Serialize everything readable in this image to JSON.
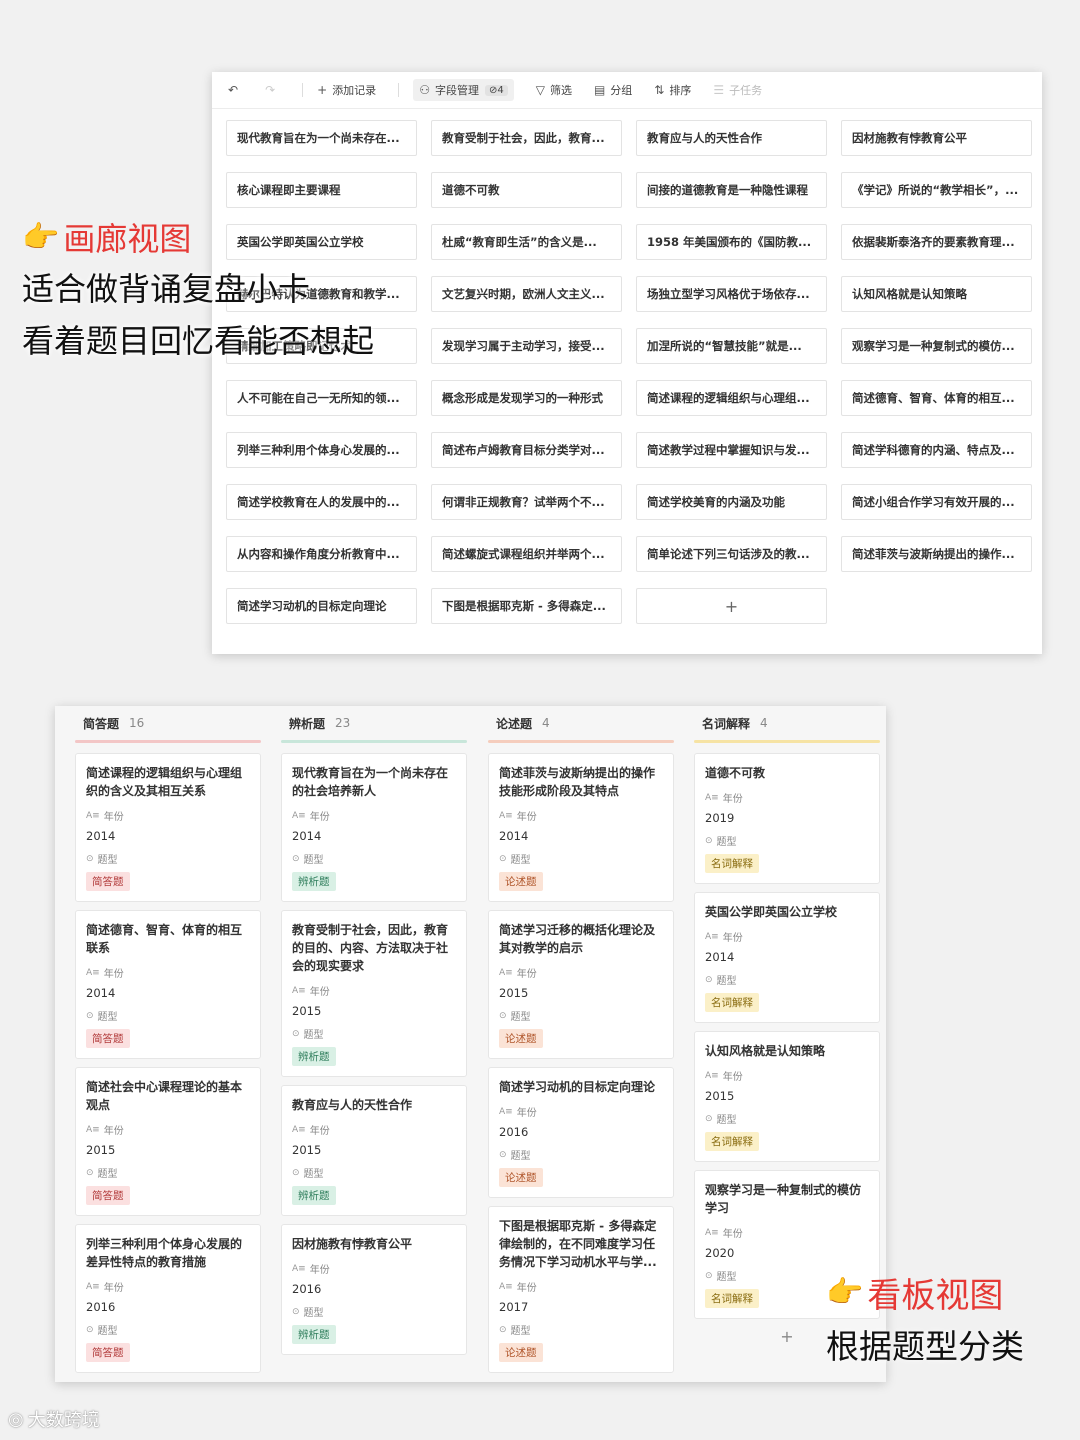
{
  "toolbar": {
    "undo_icon": "undo-icon",
    "redo_icon": "redo-icon",
    "add_record": "添加记录",
    "field_manage": "字段管理",
    "hidden_count": "4",
    "filter": "筛选",
    "group": "分组",
    "sort": "排序",
    "subtask": "子任务"
  },
  "gallery": {
    "cards": [
      "现代教育旨在为一个尚未存在...",
      "教育受制于社会，因此，教育...",
      "教育应与人的天性合作",
      "因材施教有悖教育公平",
      "核心课程即主要课程",
      "道德不可教",
      "间接的道德教育是一种隐性课程",
      "《学记》所说的“教学相长”，...",
      "英国公学即英国公立学校",
      "杜威“教育即生活”的含义是...",
      "1958 年美国颁布的《国防教...",
      "依据裴斯泰洛齐的要素教育理...",
      "赫尔巴特认为道德教育和教学...",
      "文艺复兴时期，欧洲人文主义...",
      "场独立型学习风格优于场依存...",
      "认知风格就是认知策略",
      "精细加工策略即记忆术",
      "发现学习属于主动学习，接受...",
      "加涅所说的“智慧技能”就是...",
      "观察学习是一种复制式的模仿...",
      "人不可能在自己一无所知的领...",
      "概念形成是发现学习的一种形式",
      "简述课程的逻辑组织与心理组...",
      "简述德育、智育、体育的相互...",
      "列举三种利用个体身心发展的...",
      "简述布卢姆教育目标分类学对...",
      "简述教学过程中掌握知识与发...",
      "简述学科德育的内涵、特点及...",
      "简述学校教育在人的发展中的...",
      "何谓非正规教育？试举两个不...",
      "简述学校美育的内涵及功能",
      "简述小组合作学习有效开展的...",
      "从内容和操作角度分析教育中...",
      "简述螺旋式课程组织并举两个...",
      "简单论述下列三句话涉及的教...",
      "简述菲茨与波斯纳提出的操作...",
      "简述学习动机的目标定向理论",
      "下图是根据耶克斯 - 多得森定..."
    ],
    "add_label": "+"
  },
  "caption_left": {
    "hand": "👉",
    "title": "画廊视图",
    "line1": "适合做背诵复盘小卡",
    "line2": "看着题目回忆看能否想起"
  },
  "kanban": {
    "field_year": "年份",
    "field_type": "题型",
    "add_label": "+",
    "columns": [
      {
        "name": "简答题",
        "count": "16",
        "bar_color": "#f3c6c6",
        "tag_bg": "#fbe0e0",
        "tag_fg": "#b23b3b",
        "cards": [
          {
            "title": "简述课程的逻辑组织与心理组织的含义及其相互关系",
            "year": "2014",
            "tag": "简答题"
          },
          {
            "title": "简述德育、智育、体育的相互联系",
            "year": "2014",
            "tag": "简答题"
          },
          {
            "title": "简述社会中心课程理论的基本观点",
            "year": "2015",
            "tag": "简答题"
          },
          {
            "title": "列举三种利用个体身心发展的差异性特点的教育措施",
            "year": "2016",
            "tag": "简答题"
          }
        ]
      },
      {
        "name": "辨析题",
        "count": "23",
        "bar_color": "#c8e6da",
        "tag_bg": "#d9f0e5",
        "tag_fg": "#2e7d5b",
        "cards": [
          {
            "title": "现代教育旨在为一个尚未存在的社会培养新人",
            "year": "2014",
            "tag": "辨析题"
          },
          {
            "title": "教育受制于社会，因此，教育的目的、内容、方法取决于社会的现实要求",
            "year": "2015",
            "tag": "辨析题"
          },
          {
            "title": "教育应与人的天性合作",
            "year": "2015",
            "tag": "辨析题"
          },
          {
            "title": "因材施教有悖教育公平",
            "year": "2016",
            "tag": "辨析题"
          }
        ]
      },
      {
        "name": "论述题",
        "count": "4",
        "bar_color": "#f5cdbd",
        "tag_bg": "#fbe3d6",
        "tag_fg": "#b0562b",
        "cards": [
          {
            "title": "简述菲茨与波斯纳提出的操作技能形成阶段及其特点",
            "year": "2014",
            "tag": "论述题"
          },
          {
            "title": "简述学习迁移的概括化理论及其对教学的启示",
            "year": "2015",
            "tag": "论述题"
          },
          {
            "title": "简述学习动机的目标定向理论",
            "year": "2016",
            "tag": "论述题"
          },
          {
            "title": "下图是根据耶克斯 - 多得森定律绘制的，在不同难度学习任务情况下学习动机水平与学...",
            "year": "2017",
            "tag": "论述题"
          }
        ]
      },
      {
        "name": "名词解释",
        "count": "4",
        "bar_color": "#f6e3a4",
        "tag_bg": "#fbf0c8",
        "tag_fg": "#8a6d12",
        "cards": [
          {
            "title": "道德不可教",
            "year": "2019",
            "tag": "名词解释"
          },
          {
            "title": "英国公学即英国公立学校",
            "year": "2014",
            "tag": "名词解释"
          },
          {
            "title": "认知风格就是认知策略",
            "year": "2015",
            "tag": "名词解释"
          },
          {
            "title": "观察学习是一种复制式的模仿学习",
            "year": "2020",
            "tag": "名词解释"
          }
        ]
      }
    ]
  },
  "caption_right": {
    "hand": "👉",
    "title": "看板视图",
    "line1": "根据题型分类"
  },
  "brand": {
    "logo_icon": "weibo-logo-icon",
    "name": "大数跨境"
  }
}
